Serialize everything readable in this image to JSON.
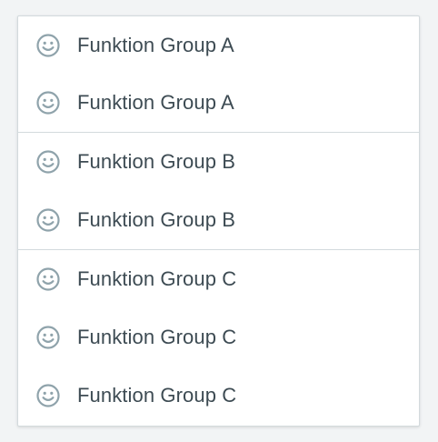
{
  "colors": {
    "icon": "#8fa3ab",
    "text": "#3d4b53",
    "divider": "#d3dadd",
    "background": "#f2f4f5",
    "surface": "#ffffff"
  },
  "menu": {
    "groups": [
      {
        "items": [
          {
            "icon": "smiley-icon",
            "label": "Funktion Group A"
          },
          {
            "icon": "smiley-icon",
            "label": "Funktion Group A"
          }
        ]
      },
      {
        "items": [
          {
            "icon": "smiley-icon",
            "label": "Funktion Group B"
          },
          {
            "icon": "smiley-icon",
            "label": "Funktion Group B"
          }
        ]
      },
      {
        "items": [
          {
            "icon": "smiley-icon",
            "label": "Funktion Group C"
          },
          {
            "icon": "smiley-icon",
            "label": "Funktion Group C"
          },
          {
            "icon": "smiley-icon",
            "label": "Funktion Group C"
          }
        ]
      }
    ]
  }
}
